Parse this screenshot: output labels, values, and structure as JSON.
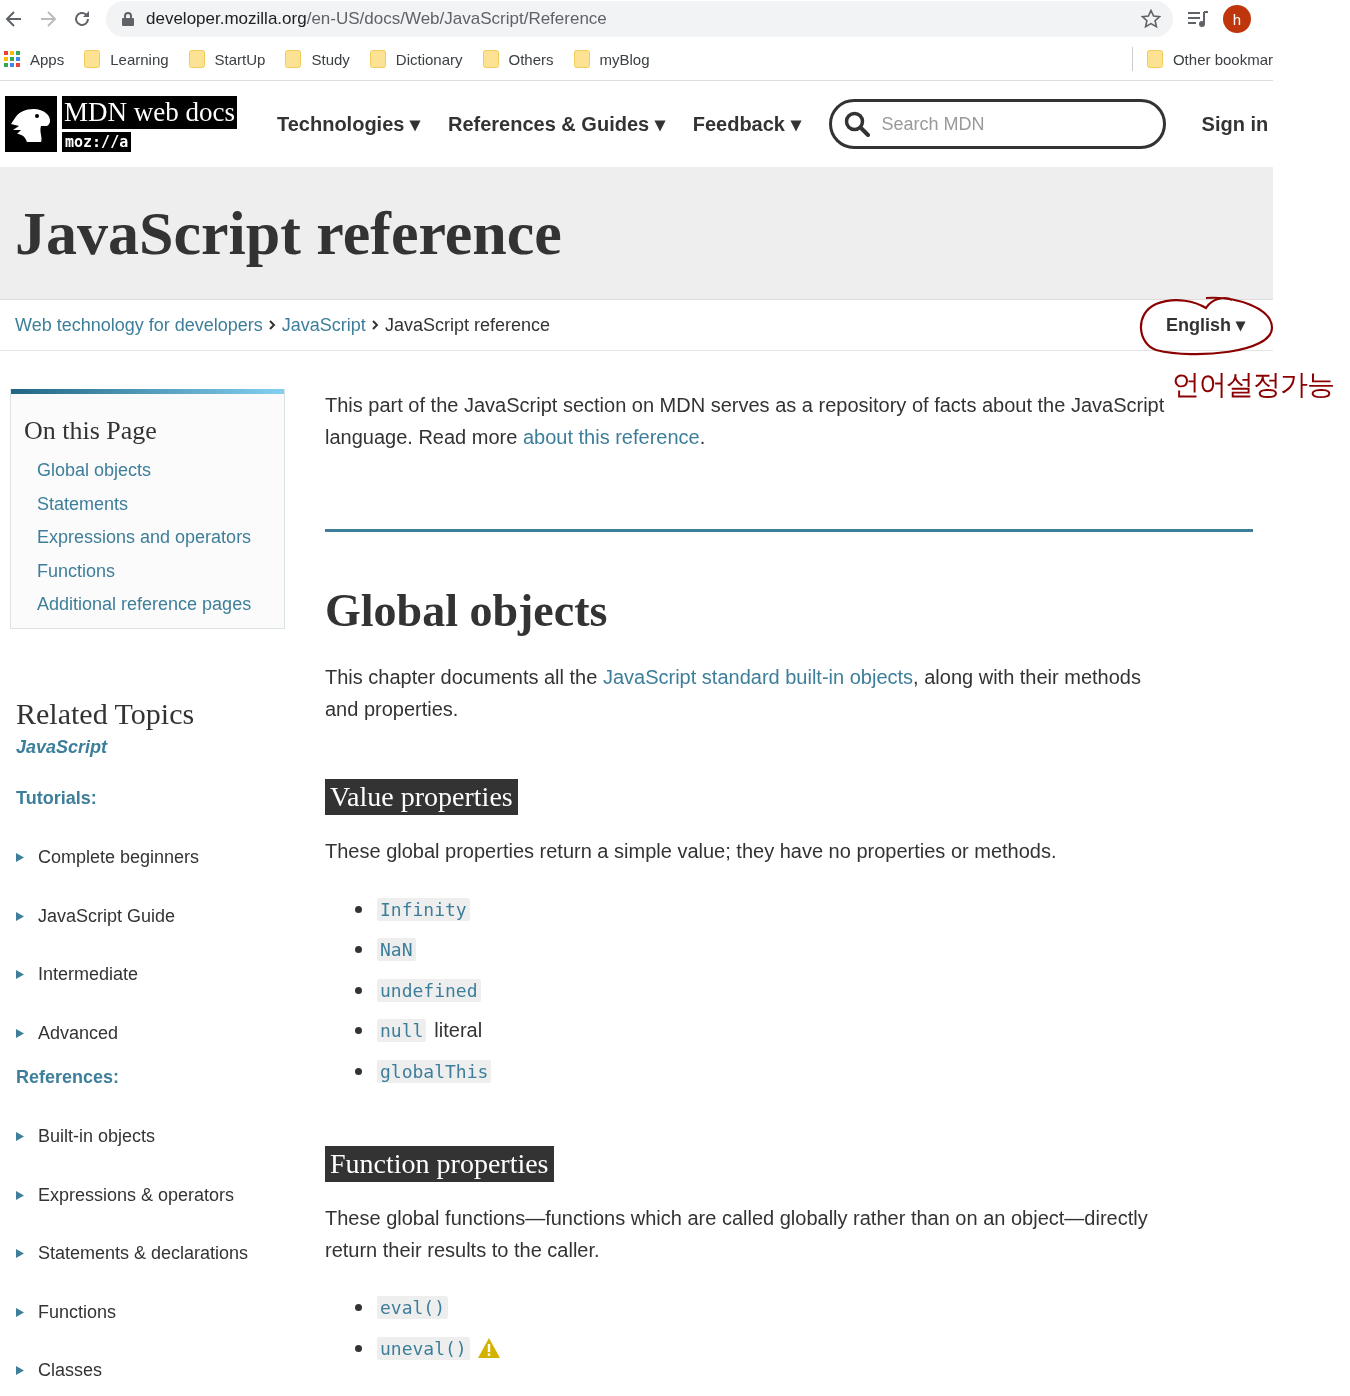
{
  "browser": {
    "url": {
      "domain": "developer.mozilla.org",
      "path": "/en-US/docs/Web/JavaScript/Reference"
    },
    "avatar": "h"
  },
  "bookmarks": [
    {
      "label": "Apps",
      "kind": "apps"
    },
    {
      "label": "Learning",
      "kind": "folder"
    },
    {
      "label": "StartUp",
      "kind": "folder"
    },
    {
      "label": "Study",
      "kind": "folder"
    },
    {
      "label": "Dictionary",
      "kind": "folder"
    },
    {
      "label": "Others",
      "kind": "folder"
    },
    {
      "label": "myBlog",
      "kind": "folder"
    }
  ],
  "other_bookmarks": "Other bookmar",
  "header": {
    "logo": {
      "title": "MDN web docs",
      "subtitle": "moz://a"
    },
    "nav": [
      "Technologies ▾",
      "References & Guides ▾",
      "Feedback ▾"
    ],
    "search": {
      "placeholder": "Search MDN"
    },
    "sign_in": "Sign in"
  },
  "page_title": "JavaScript reference",
  "breadcrumbs": [
    {
      "label": "Web technology for developers",
      "link": true
    },
    {
      "label": "JavaScript",
      "link": true
    },
    {
      "label": "JavaScript reference",
      "link": false
    }
  ],
  "language": "English ▾",
  "annotation": {
    "text": "언어설정가능"
  },
  "sidebar": {
    "on_this_page": {
      "title": "On this Page",
      "items": [
        "Global objects",
        "Statements",
        "Expressions and operators",
        "Functions",
        "Additional reference pages"
      ]
    },
    "related": {
      "title": "Related Topics",
      "subject": "JavaScript",
      "groups": [
        {
          "heading": "Tutorials:",
          "items": [
            "Complete beginners",
            "JavaScript Guide",
            "Intermediate",
            "Advanced"
          ]
        },
        {
          "heading": "References:",
          "items": [
            "Built-in objects",
            "Expressions & operators",
            "Statements & declarations",
            "Functions",
            "Classes"
          ]
        }
      ]
    }
  },
  "intro": {
    "before": "This part of the JavaScript section on MDN serves as a repository of facts about the JavaScript language. Read more ",
    "link": "about this reference",
    "after": "."
  },
  "sections": [
    {
      "kind": "h2",
      "heading": "Global objects",
      "paragraph": {
        "before": "This chapter documents all the ",
        "link": "JavaScript standard built-in objects",
        "after": ", along with their methods and properties."
      }
    },
    {
      "kind": "h3",
      "heading": "Value properties",
      "paragraph": {
        "before": "These global properties return a simple value; they have no properties or methods."
      },
      "items": [
        {
          "code": "Infinity"
        },
        {
          "code": "NaN"
        },
        {
          "code": "undefined"
        },
        {
          "code": "null",
          "suffix": "literal"
        },
        {
          "code": "globalThis"
        }
      ]
    },
    {
      "kind": "h3",
      "heading": "Function properties",
      "paragraph": {
        "before": "These global functions—functions which are called globally rather than on an object—directly return their results to the caller."
      },
      "items": [
        {
          "code": "eval()"
        },
        {
          "code": "uneval()",
          "warning": true
        }
      ]
    }
  ]
}
